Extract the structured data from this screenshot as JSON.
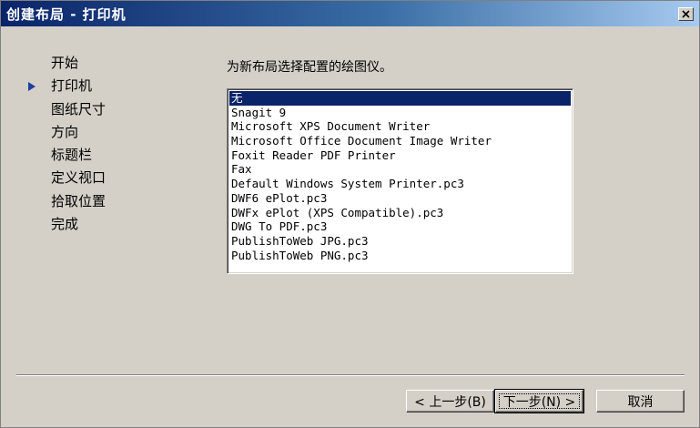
{
  "window": {
    "title": "创建布局 - 打印机"
  },
  "steps": [
    {
      "label": "开始"
    },
    {
      "label": "打印机",
      "current": true
    },
    {
      "label": "图纸尺寸"
    },
    {
      "label": "方向"
    },
    {
      "label": "标题栏"
    },
    {
      "label": "定义视口"
    },
    {
      "label": "拾取位置"
    },
    {
      "label": "完成"
    }
  ],
  "prompt": "为新布局选择配置的绘图仪。",
  "plotters": {
    "selected_index": 0,
    "items": [
      "无",
      "Snagit 9",
      "Microsoft XPS Document Writer",
      "Microsoft Office Document Image Writer",
      "Foxit Reader PDF Printer",
      "Fax",
      "Default Windows System Printer.pc3",
      "DWF6 ePlot.pc3",
      "DWFx ePlot (XPS Compatible).pc3",
      "DWG To PDF.pc3",
      "PublishToWeb JPG.pc3",
      "PublishToWeb PNG.pc3"
    ]
  },
  "buttons": {
    "back": "< 上一步(B)",
    "next": "下一步(N) >",
    "cancel": "取消"
  },
  "colors": {
    "accent": "#0a246a",
    "current_step_arrow": "#1f3f9f"
  }
}
